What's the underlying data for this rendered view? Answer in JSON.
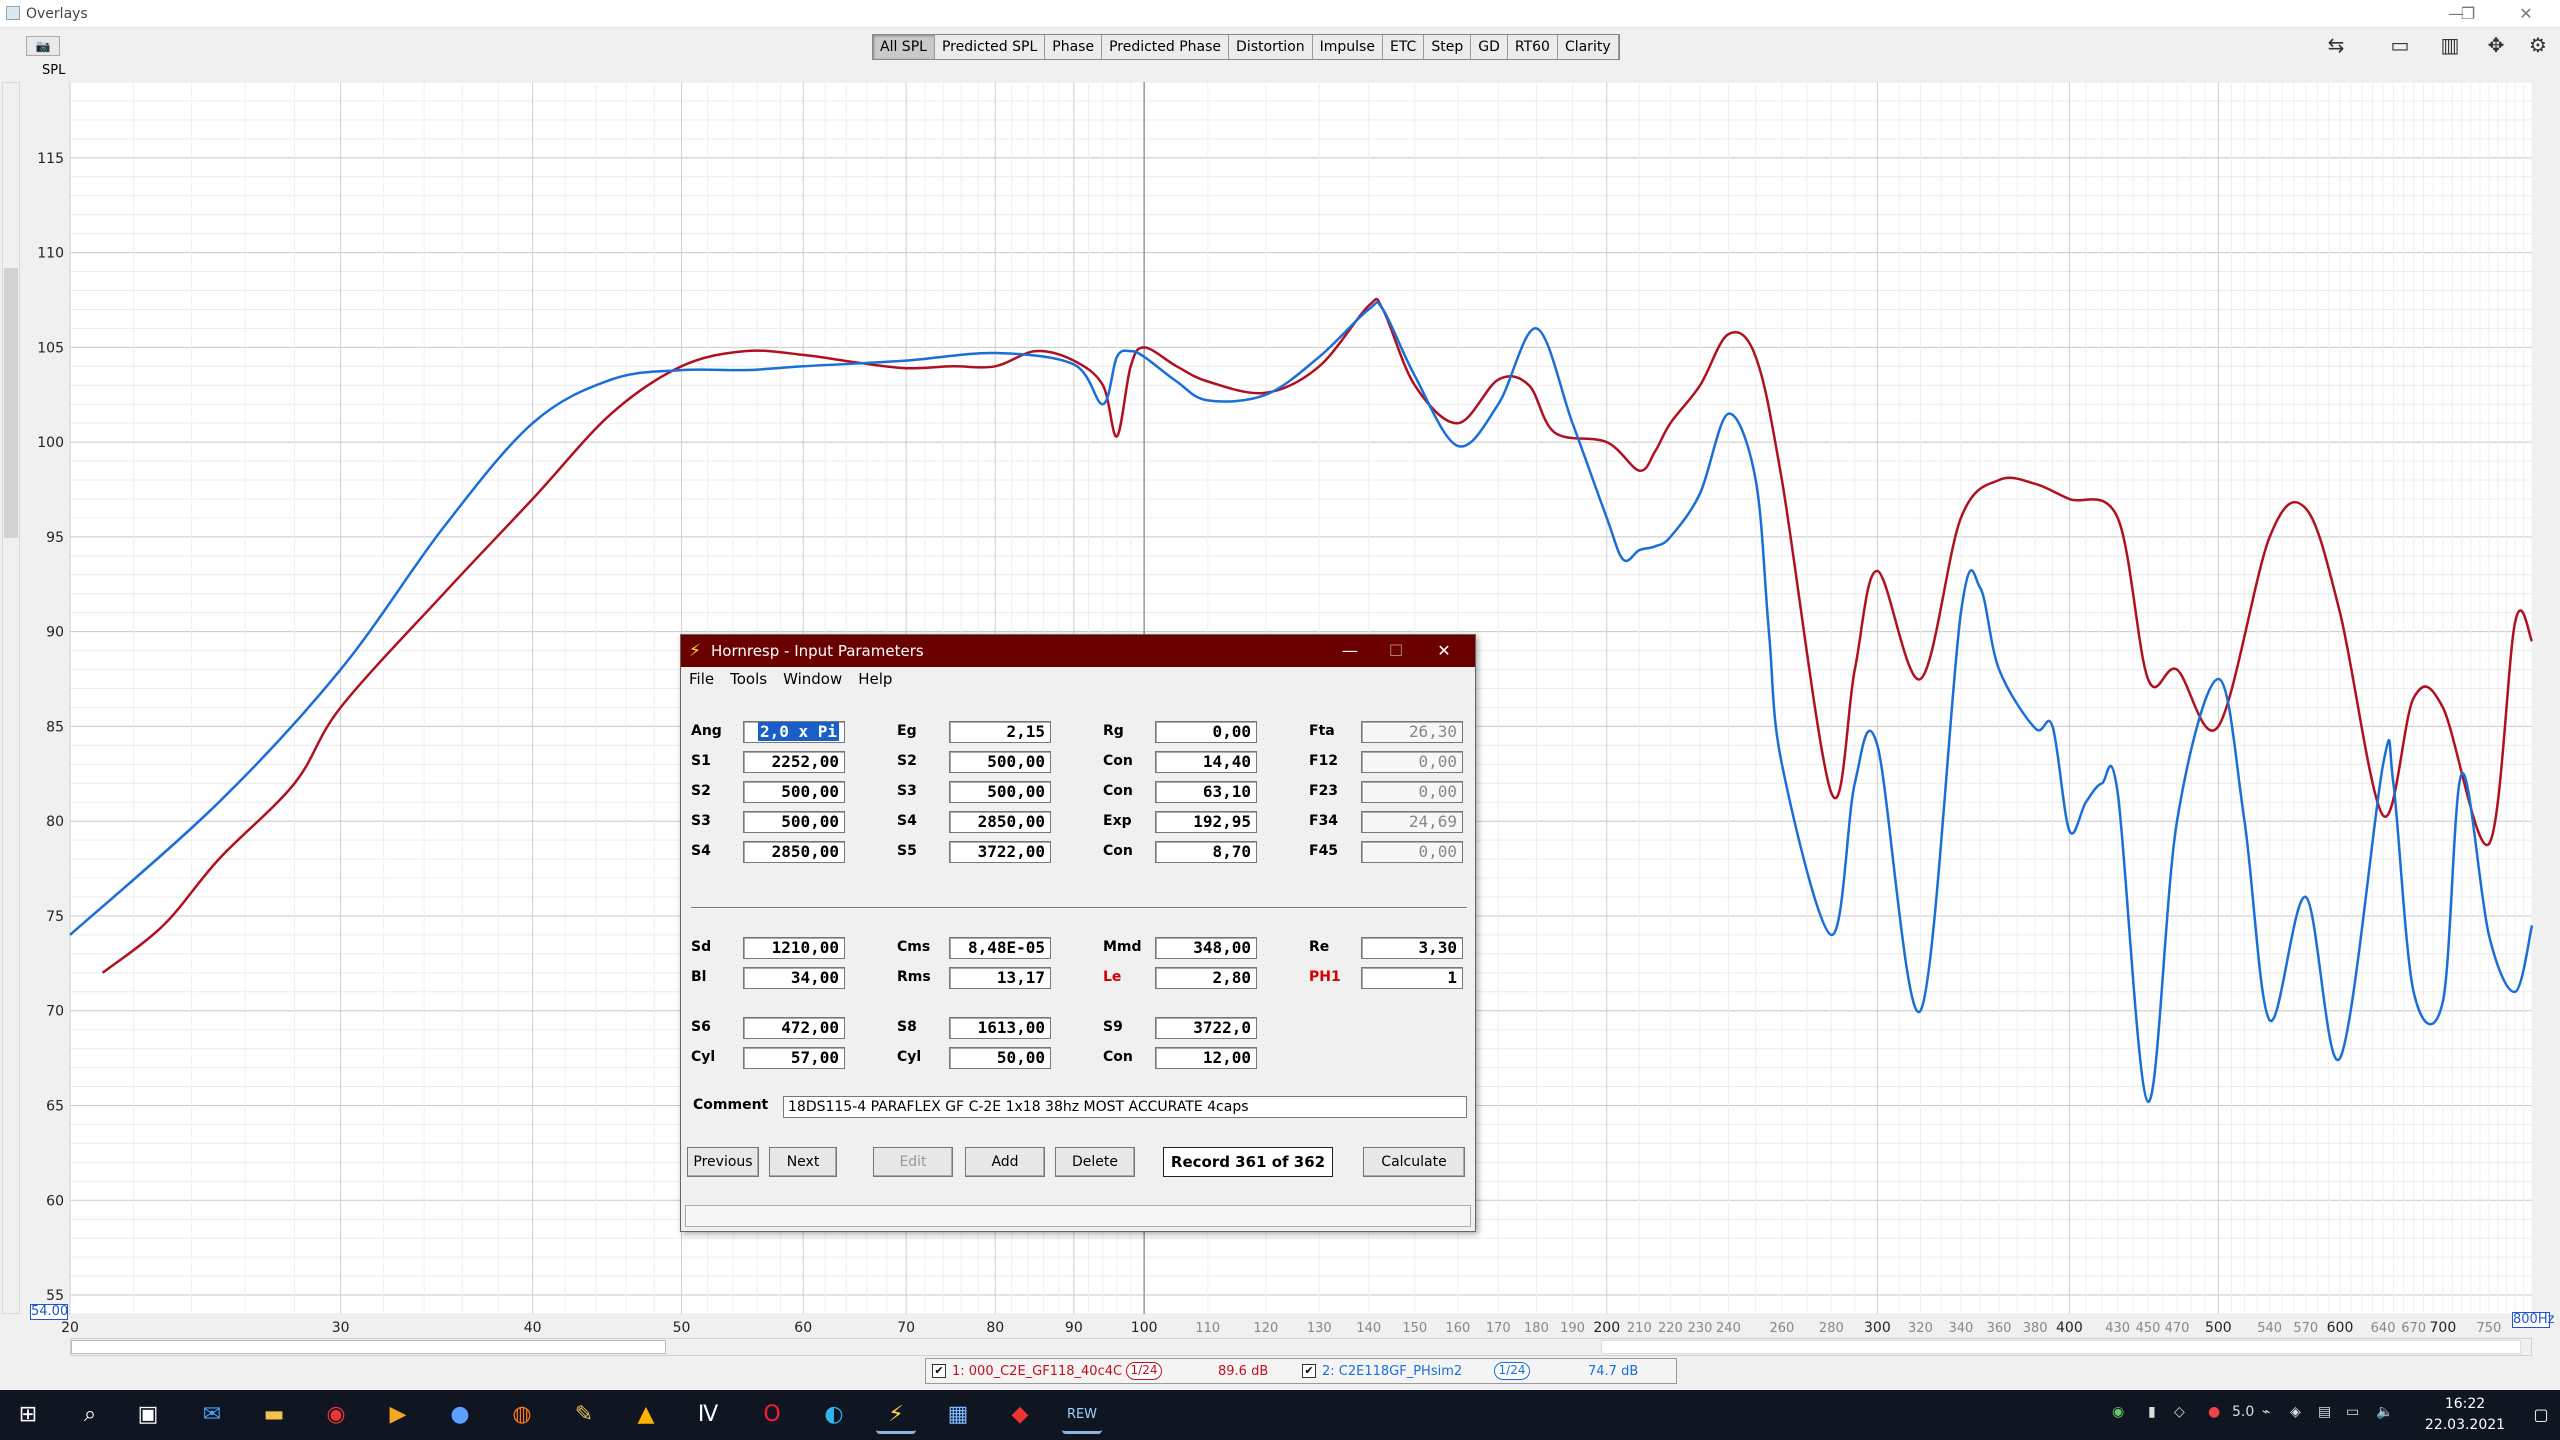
{
  "window": {
    "title": "Overlays"
  },
  "toolbar": {
    "spl_label": "SPL",
    "tabs": [
      "All SPL",
      "Predicted SPL",
      "Phase",
      "Predicted Phase",
      "Distortion",
      "Impulse",
      "ETC",
      "Step",
      "GD",
      "RT60",
      "Clarity"
    ],
    "active_tab": "All SPL"
  },
  "chart_data": {
    "type": "line",
    "xscale": "log",
    "xlim": [
      20,
      800
    ],
    "ylim": [
      54,
      119
    ],
    "grid": true,
    "y_ticks": [
      55,
      60,
      65,
      70,
      75,
      80,
      85,
      90,
      95,
      100,
      105,
      110,
      115
    ],
    "x_ticks": [
      20,
      30,
      40,
      50,
      60,
      70,
      80,
      90,
      100,
      110,
      120,
      130,
      140,
      150,
      160,
      170,
      180,
      190,
      200,
      210,
      220,
      230,
      240,
      260,
      280,
      300,
      320,
      340,
      360,
      380,
      400,
      430,
      450,
      470,
      500,
      540,
      570,
      600,
      640,
      670,
      700,
      750
    ],
    "x_tick_labels": [
      "20",
      "30",
      "40",
      "50",
      "60",
      "70",
      "80",
      "90",
      "100",
      "110",
      "120",
      "130",
      "140",
      "150",
      "160",
      "170",
      "180",
      "190",
      "200",
      "210",
      "220",
      "230",
      "240",
      "260",
      "280",
      "300",
      "320",
      "340",
      "360",
      "380",
      "400",
      "430",
      "450",
      "470",
      "500",
      "540",
      "570",
      "600",
      "640",
      "670",
      "700",
      "750"
    ],
    "ymin_label": "54.00",
    "xmax_label": "800Hz",
    "series": [
      {
        "name": "1: 000_C2E_GF118_40c4C",
        "color": "#b01020",
        "x": [
          21,
          23,
          25,
          28,
          30,
          35,
          40,
          45,
          50,
          55,
          60,
          65,
          70,
          75,
          80,
          85,
          90,
          94,
          96,
          98,
          100,
          105,
          110,
          120,
          130,
          140,
          143,
          150,
          160,
          170,
          178,
          185,
          200,
          210,
          215,
          220,
          230,
          240,
          250,
          260,
          280,
          290,
          300,
          320,
          340,
          360,
          380,
          400,
          430,
          450,
          470,
          500,
          540,
          570,
          600,
          640,
          670,
          700,
          750,
          780,
          800
        ],
        "y": [
          72,
          74.5,
          78,
          82,
          86,
          92,
          97,
          101.5,
          104,
          104.8,
          104.6,
          104.2,
          103.9,
          104,
          104,
          104.8,
          104.3,
          103,
          100.3,
          104,
          105,
          104,
          103.2,
          102.6,
          104,
          107.2,
          107,
          103,
          101,
          103.3,
          103,
          100.5,
          100,
          98.5,
          99.5,
          101,
          103,
          105.7,
          104.5,
          98,
          81.5,
          88,
          93.2,
          87.5,
          96,
          98,
          97.8,
          97,
          96,
          87.5,
          88,
          85,
          95,
          96.5,
          91,
          80.3,
          86.5,
          86,
          78.8,
          90.5,
          89.5
        ]
      },
      {
        "name": "2: C2E118GF_PHsim2",
        "color": "#1a6ed8",
        "x": [
          20,
          25,
          30,
          35,
          40,
          45,
          50,
          55,
          60,
          70,
          80,
          90,
          94,
          96,
          98,
          100,
          105,
          110,
          120,
          130,
          140,
          143,
          150,
          160,
          170,
          180,
          190,
          200,
          205,
          210,
          215,
          220,
          230,
          240,
          250,
          255,
          260,
          280,
          290,
          300,
          320,
          340,
          350,
          360,
          380,
          390,
          400,
          410,
          420,
          430,
          450,
          470,
          500,
          520,
          540,
          570,
          600,
          640,
          650,
          670,
          700,
          720,
          750,
          780,
          800
        ],
        "y": [
          74,
          81,
          88,
          95.5,
          101,
          103.3,
          103.8,
          103.8,
          104,
          104.3,
          104.7,
          104.1,
          102,
          104.5,
          104.8,
          104.5,
          103.2,
          102.2,
          102.5,
          104.5,
          107,
          107,
          103.5,
          99.8,
          102,
          106,
          101,
          96,
          93.8,
          94.3,
          94.5,
          95,
          97.3,
          101.5,
          98,
          90,
          83,
          74,
          82,
          84,
          70,
          91,
          92.3,
          88,
          84.9,
          85,
          79.5,
          81,
          82,
          81.5,
          65.2,
          80,
          87.5,
          80,
          69.5,
          76,
          67.5,
          83,
          82,
          71,
          70.5,
          82.5,
          74,
          71,
          74.5
        ]
      }
    ]
  },
  "legend": {
    "entry1": {
      "label": "1: 000_C2E_GF118_40c4C",
      "smoothing": "1/24",
      "level": "89.6 dB"
    },
    "entry2": {
      "label": "2: C2E118GF_PHsim2",
      "smoothing": "1/24",
      "level": "74.7 dB"
    }
  },
  "dialog": {
    "title": "Hornresp - Input Parameters",
    "menu": [
      "File",
      "Tools",
      "Window",
      "Help"
    ],
    "rows": [
      [
        {
          "l": "Ang",
          "v": "2,0 x Pi"
        },
        {
          "l": "Eg",
          "v": "2,15"
        },
        {
          "l": "Rg",
          "v": "0,00"
        },
        {
          "l": "Fta",
          "v": "26,30"
        }
      ],
      [
        {
          "l": "S1",
          "v": "2252,00"
        },
        {
          "l": "S2",
          "v": "500,00"
        },
        {
          "l": "Con",
          "v": "14,40"
        },
        {
          "l": "F12",
          "v": "0,00"
        }
      ],
      [
        {
          "l": "S2",
          "v": "500,00"
        },
        {
          "l": "S3",
          "v": "500,00"
        },
        {
          "l": "Con",
          "v": "63,10"
        },
        {
          "l": "F23",
          "v": "0,00"
        }
      ],
      [
        {
          "l": "S3",
          "v": "500,00"
        },
        {
          "l": "S4",
          "v": "2850,00"
        },
        {
          "l": "Exp",
          "v": "192,95"
        },
        {
          "l": "F34",
          "v": "24,69"
        }
      ],
      [
        {
          "l": "S4",
          "v": "2850,00"
        },
        {
          "l": "S5",
          "v": "3722,00"
        },
        {
          "l": "Con",
          "v": "8,70"
        },
        {
          "l": "F45",
          "v": "0,00"
        }
      ],
      [
        {
          "l": "Sd",
          "v": "1210,00"
        },
        {
          "l": "Cms",
          "v": "8,48E-05"
        },
        {
          "l": "Mmd",
          "v": "348,00"
        },
        {
          "l": "Re",
          "v": "3,30"
        }
      ],
      [
        {
          "l": "Bl",
          "v": "34,00"
        },
        {
          "l": "Rms",
          "v": "13,17"
        },
        {
          "l": "Le",
          "v": "2,80"
        },
        {
          "l": "PH1",
          "v": "1"
        }
      ],
      [
        {
          "l": "S6",
          "v": "472,00"
        },
        {
          "l": "S8",
          "v": "1613,00"
        },
        {
          "l": "S9",
          "v": "3722,0"
        }
      ],
      [
        {
          "l": "Cyl",
          "v": "57,00"
        },
        {
          "l": "Cyl",
          "v": "50,00"
        },
        {
          "l": "Con",
          "v": "12,00"
        }
      ]
    ],
    "comment_label": "Comment",
    "comment": "18DS115-4 PARAFLEX GF C-2E 1x18 38hz MOST ACCURATE  4caps",
    "buttons": {
      "previous": "Previous",
      "next": "Next",
      "edit": "Edit",
      "add": "Add",
      "delete": "Delete",
      "calculate": "Calculate"
    },
    "record": "Record 361 of 362"
  },
  "taskbar": {
    "time": "16:22",
    "date": "22.03.2021",
    "tray_text": "5.0"
  }
}
